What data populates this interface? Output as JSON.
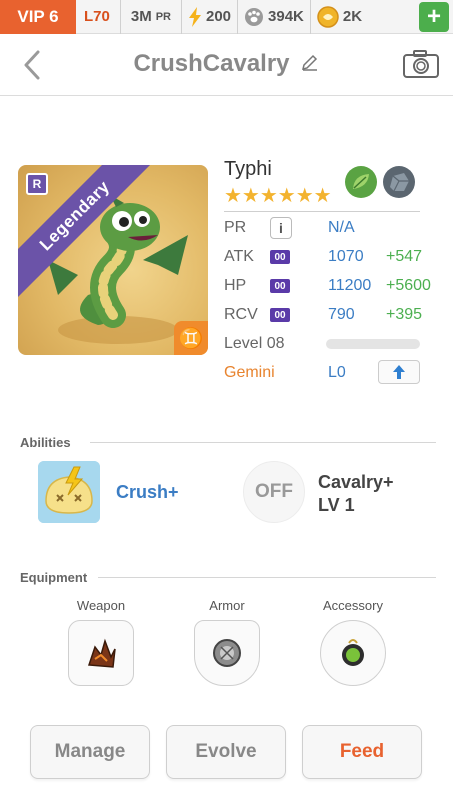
{
  "topbar": {
    "vip": "VIP 6",
    "level": "L70",
    "pr_value": "3M",
    "pr_label": "PR",
    "energy": "200",
    "paw": "394K",
    "coins": "2K",
    "plus_label": "+"
  },
  "header": {
    "title": "CrushCavalry"
  },
  "card": {
    "rarity": "Legendary",
    "rank_letter": "R",
    "zodiac_symbol": "♊",
    "name": "Typhi",
    "stars": "★★★★★★",
    "element_icons": [
      "leaf-icon",
      "rock-icon"
    ]
  },
  "stats": {
    "pr": {
      "label": "PR",
      "info": "i",
      "value": "N/A"
    },
    "atk": {
      "label": "ATK",
      "tag": "00",
      "value": "1070",
      "bonus": "+547"
    },
    "hp": {
      "label": "HP",
      "tag": "00",
      "value": "11200",
      "bonus": "+5600"
    },
    "rcv": {
      "label": "RCV",
      "tag": "00",
      "value": "790",
      "bonus": "+395"
    },
    "level": {
      "label": "Level 08",
      "progress": 0
    },
    "zodiac": {
      "label": "Gemini",
      "value": "L0"
    }
  },
  "abilities": {
    "section_label": "Abilities",
    "ability1": {
      "name": "Crush+"
    },
    "ability2": {
      "state": "OFF",
      "name": "Cavalry+",
      "level": "LV 1"
    }
  },
  "equipment": {
    "section_label": "Equipment",
    "slots": [
      {
        "label": "Weapon"
      },
      {
        "label": "Armor"
      },
      {
        "label": "Accessory"
      }
    ]
  },
  "actions": {
    "manage": "Manage",
    "evolve": "Evolve",
    "feed": "Feed"
  },
  "colors": {
    "accent_orange": "#e8622f",
    "link_blue": "#3b7dc4",
    "bonus_green": "#4caf50",
    "legendary_purple": "#6b53a8"
  }
}
